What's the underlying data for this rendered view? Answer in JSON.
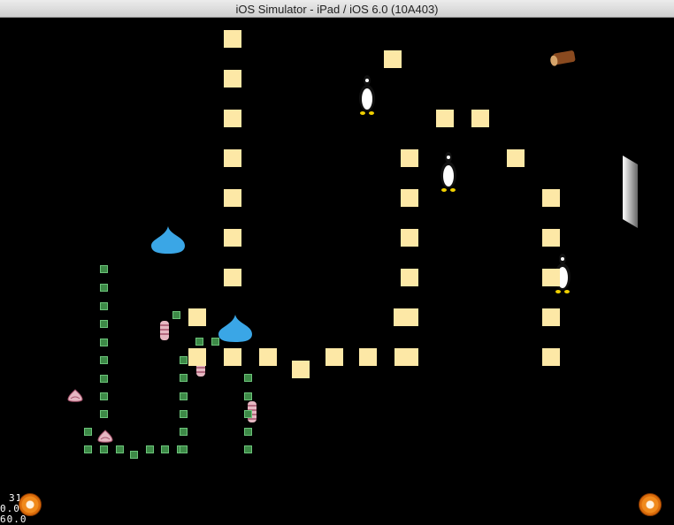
{
  "window": {
    "title": "iOS Simulator - iPad / iOS 6.0 (10A403)"
  },
  "hud": {
    "line1": "31",
    "line2": "0.016",
    "line3": "60.0"
  },
  "sprites": {
    "block_color": "#fde8a6",
    "green_marker_color": "#3d8a47",
    "slime_color": "#3aa6e6"
  },
  "controls": {
    "left_button_icon": "pause-icon",
    "right_button_icon": "swirl-icon"
  }
}
